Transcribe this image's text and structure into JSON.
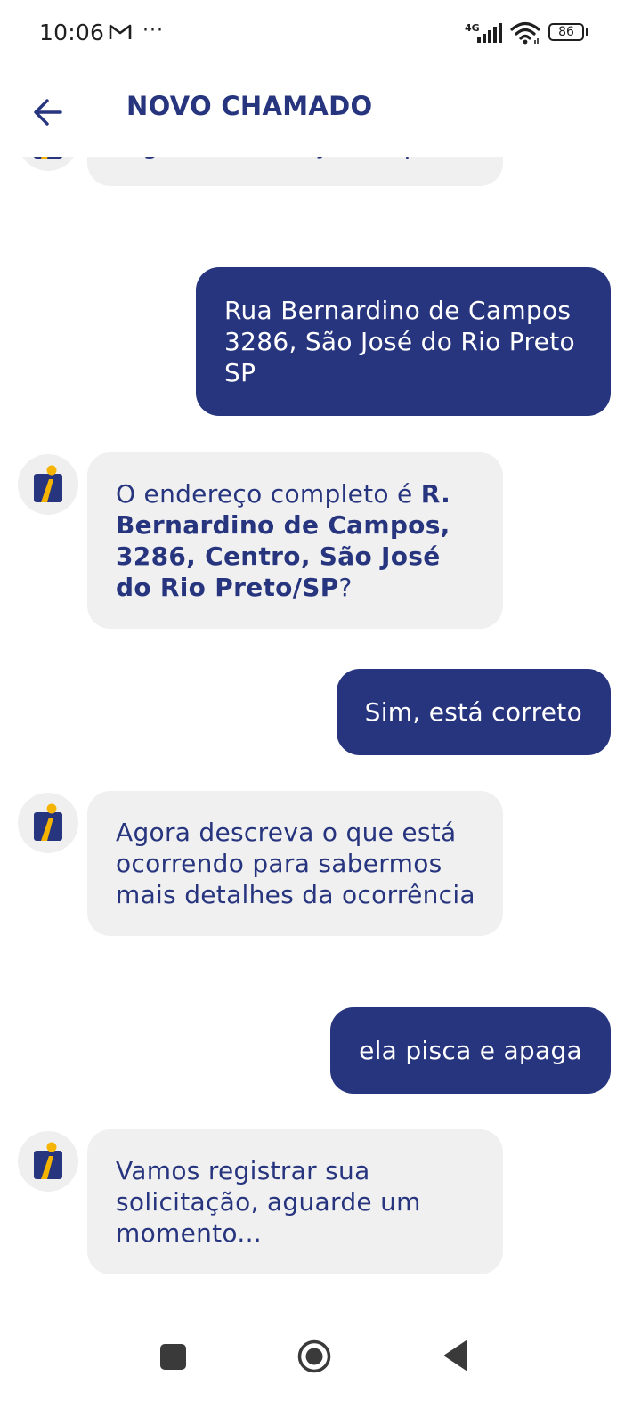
{
  "status_bar": {
    "time": "10:06",
    "network": "4G",
    "battery": "86",
    "icons": [
      "gmail-icon",
      "more-dots-icon",
      "signal-icon",
      "wifi-icon",
      "battery-icon"
    ]
  },
  "header": {
    "title": "NOVO CHAMADO",
    "back_icon": "arrow-left-icon"
  },
  "colors": {
    "brand": "#27357f",
    "bot_bubble": "#f0f0f0",
    "accent": "#f5b400"
  },
  "messages": [
    {
      "sender": "bot",
      "text": "Digite o endereço completo"
    },
    {
      "sender": "user",
      "text": "Rua Bernardino de Campos 3286, São José do Rio Preto SP"
    },
    {
      "sender": "bot",
      "text_prefix": "O endereço completo é ",
      "text_bold": "R. Bernardino de Campos, 3286, Centro, São José do Rio Preto/SP",
      "text_suffix": "?"
    },
    {
      "sender": "user",
      "text": "Sim, está correto"
    },
    {
      "sender": "bot",
      "text": "Agora descreva o que está ocorrendo para sabermos mais detalhes da ocorrência"
    },
    {
      "sender": "user",
      "text": "ela pisca e apaga"
    },
    {
      "sender": "bot",
      "text": "Vamos registrar sua solicitação, aguarde um momento..."
    }
  ],
  "nav_bar": {
    "icons": [
      "recent-apps-icon",
      "home-icon",
      "back-triangle-icon"
    ]
  }
}
